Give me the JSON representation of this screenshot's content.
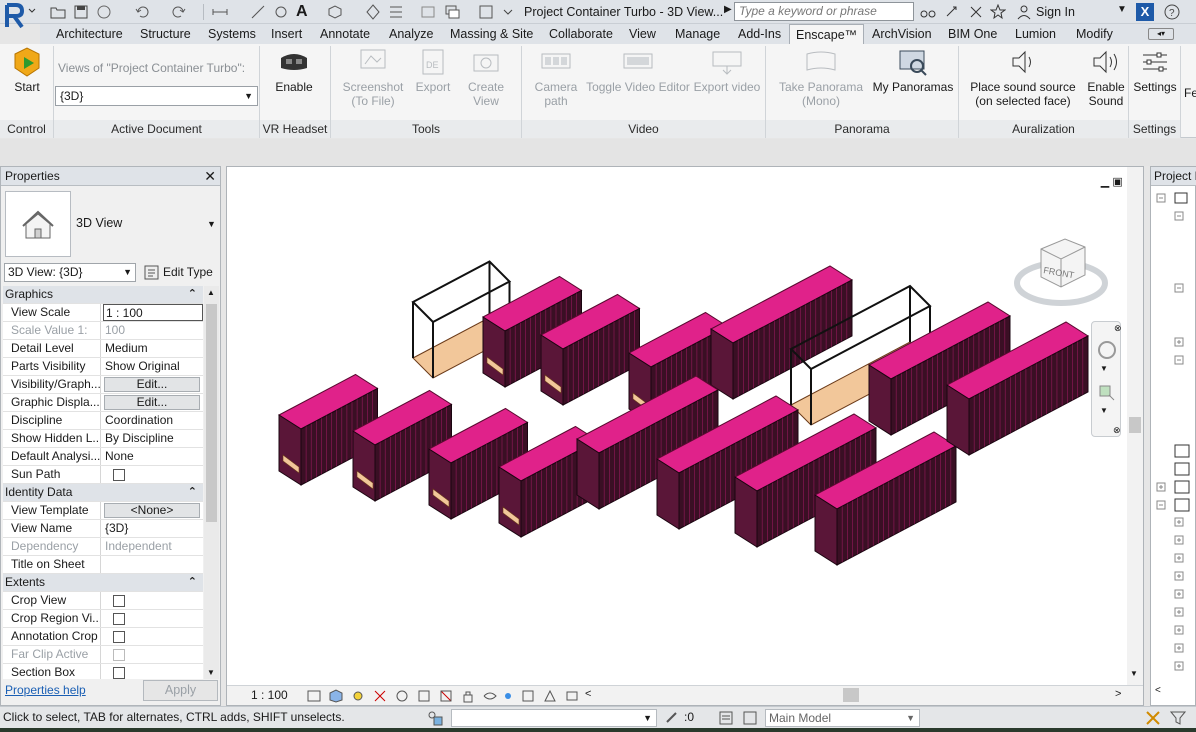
{
  "window": {
    "doc_title": "Project Container Turbo - 3D View...",
    "search_placeholder": "Type a keyword or phrase",
    "sign_in": "Sign In"
  },
  "tabs": [
    "Architecture",
    "Structure",
    "Systems",
    "Insert",
    "Annotate",
    "Analyze",
    "Massing & Site",
    "Collaborate",
    "View",
    "Manage",
    "Add-Ins",
    "Enscape™",
    "ArchVision",
    "BIM One",
    "Lumion",
    "Modify"
  ],
  "active_tab": "Enscape™",
  "ribbon": {
    "control": {
      "start": "Start",
      "panel": "Control"
    },
    "active_document": {
      "views_of": "Views of \"Project Container Turbo\":",
      "view_selected": "{3D}",
      "panel": "Active Document"
    },
    "vr": {
      "enable": "Enable",
      "panel": "VR Headset"
    },
    "tools": {
      "screenshot_line1": "Screenshot",
      "screenshot_line2": "(To File)",
      "export": "Export",
      "create_view": "Create View",
      "panel": "Tools"
    },
    "video": {
      "camera_line1": "Camera",
      "camera_line2": "path",
      "toggle": "Toggle Video Editor",
      "export_video": "Export video",
      "panel": "Video"
    },
    "panorama": {
      "take_line1": "Take Panorama",
      "take_line2": "(Mono)",
      "my": "My Panoramas",
      "panel": "Panorama"
    },
    "auralization": {
      "place_line1": "Place sound source",
      "place_line2": "(on selected face)",
      "enable_line1": "Enable",
      "enable_line2": "Sound",
      "panel": "Auralization"
    },
    "settings": {
      "settings": "Settings",
      "panel": "Settings",
      "clip": "Fe"
    }
  },
  "properties": {
    "title": "Properties",
    "type_name": "3D View",
    "instance": "3D View: {3D}",
    "edit_type": "Edit Type",
    "rows": [
      {
        "kind": "group",
        "label": "Graphics"
      },
      {
        "kind": "text",
        "label": "View Scale",
        "value": "1 : 100",
        "boxed": true
      },
      {
        "kind": "text",
        "label": "Scale Value   1:",
        "value": "100",
        "dim": true
      },
      {
        "kind": "text",
        "label": "Detail Level",
        "value": "Medium"
      },
      {
        "kind": "text",
        "label": "Parts Visibility",
        "value": "Show Original"
      },
      {
        "kind": "button",
        "label": "Visibility/Graph...",
        "value": "Edit..."
      },
      {
        "kind": "button",
        "label": "Graphic Displa...",
        "value": "Edit..."
      },
      {
        "kind": "text",
        "label": "Discipline",
        "value": "Coordination"
      },
      {
        "kind": "text",
        "label": "Show Hidden L...",
        "value": "By Discipline"
      },
      {
        "kind": "text",
        "label": "Default Analysi...",
        "value": "None"
      },
      {
        "kind": "check",
        "label": "Sun Path",
        "value": ""
      },
      {
        "kind": "group",
        "label": "Identity Data"
      },
      {
        "kind": "button",
        "label": "View Template",
        "value": "<None>"
      },
      {
        "kind": "text",
        "label": "View Name",
        "value": "{3D}"
      },
      {
        "kind": "text",
        "label": "Dependency",
        "value": "Independent",
        "dim": true
      },
      {
        "kind": "text",
        "label": "Title on Sheet",
        "value": ""
      },
      {
        "kind": "group",
        "label": "Extents"
      },
      {
        "kind": "check",
        "label": "Crop View",
        "value": ""
      },
      {
        "kind": "check",
        "label": "Crop Region Vi...",
        "value": ""
      },
      {
        "kind": "check",
        "label": "Annotation Crop",
        "value": ""
      },
      {
        "kind": "check",
        "label": "Far Clip Active",
        "value": "",
        "dim": true
      },
      {
        "kind": "check",
        "label": "Section Box",
        "value": ""
      }
    ],
    "help": "Properties help",
    "apply": "Apply"
  },
  "view": {
    "scale": "1 : 100",
    "cube_label": "FRONT",
    "containers": [
      {
        "name": "container-open-frame-1",
        "kind": "frame"
      },
      {
        "name": "container-short-2",
        "kind": "short"
      },
      {
        "name": "container-short-3",
        "kind": "short"
      },
      {
        "name": "container-short-4",
        "kind": "short"
      },
      {
        "name": "container-long-5",
        "kind": "long"
      },
      {
        "name": "container-open-frame-6",
        "kind": "frame"
      },
      {
        "name": "container-long-7",
        "kind": "long"
      },
      {
        "name": "container-short-8",
        "kind": "short"
      },
      {
        "name": "container-short-9",
        "kind": "short"
      },
      {
        "name": "container-short-10",
        "kind": "short"
      },
      {
        "name": "container-short-11",
        "kind": "short"
      },
      {
        "name": "container-long-12",
        "kind": "long"
      },
      {
        "name": "container-long-13",
        "kind": "long"
      },
      {
        "name": "container-long-14",
        "kind": "long"
      },
      {
        "name": "container-long-15",
        "kind": "long"
      },
      {
        "name": "container-long-16",
        "kind": "long"
      }
    ]
  },
  "project_browser": {
    "title": "Project B"
  },
  "status": {
    "text": "Click to select, TAB for alternates, CTRL adds, SHIFT unselects.",
    "zero": ":0",
    "model": "Main Model"
  },
  "colors": {
    "container_body": "#3a0f24",
    "container_accent": "#e0228a",
    "floor": "#f2c79a",
    "ribbon_bg": "#f5f5f5"
  }
}
